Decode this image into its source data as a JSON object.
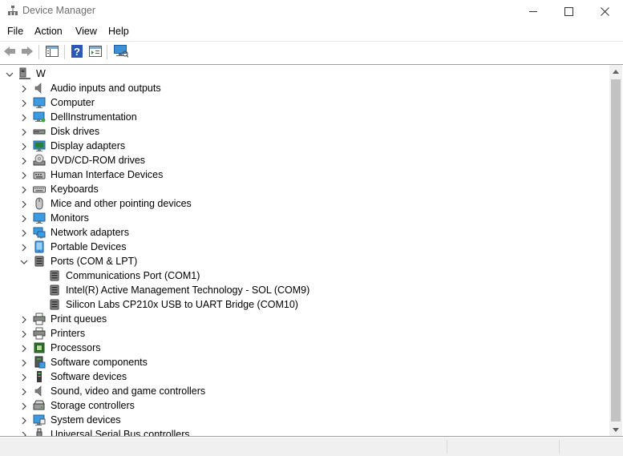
{
  "window": {
    "title": "Device Manager",
    "controls": {
      "minimize": "minimize",
      "maximize": "maximize",
      "close": "close"
    }
  },
  "menu": [
    "File",
    "Action",
    "View",
    "Help"
  ],
  "toolbar": {
    "buttons": [
      "back-icon",
      "forward-icon",
      "show-hide-console-tree-icon",
      "help-icon",
      "properties-icon",
      "scan-hardware-icon"
    ]
  },
  "tree": {
    "root": "W",
    "categories": [
      {
        "label": "Audio inputs and outputs",
        "icon": "speaker-icon",
        "expanded": false
      },
      {
        "label": "Computer",
        "icon": "monitor-icon",
        "expanded": false
      },
      {
        "label": "DellInstrumentation",
        "icon": "network-monitor-icon",
        "expanded": false
      },
      {
        "label": "Disk drives",
        "icon": "disk-drive-icon",
        "expanded": false
      },
      {
        "label": "Display adapters",
        "icon": "display-adapter-icon",
        "expanded": false
      },
      {
        "label": "DVD/CD-ROM drives",
        "icon": "dvd-icon",
        "expanded": false
      },
      {
        "label": "Human Interface Devices",
        "icon": "hid-icon",
        "expanded": false
      },
      {
        "label": "Keyboards",
        "icon": "keyboard-icon",
        "expanded": false
      },
      {
        "label": "Mice and other pointing devices",
        "icon": "mouse-icon",
        "expanded": false
      },
      {
        "label": "Monitors",
        "icon": "monitor-icon",
        "expanded": false
      },
      {
        "label": "Network adapters",
        "icon": "network-adapter-icon",
        "expanded": false
      },
      {
        "label": "Portable Devices",
        "icon": "portable-device-icon",
        "expanded": false
      },
      {
        "label": "Ports (COM & LPT)",
        "icon": "port-icon",
        "expanded": true,
        "children": [
          "Communications Port (COM1)",
          "Intel(R) Active Management Technology - SOL (COM9)",
          "Silicon Labs CP210x USB to UART Bridge (COM10)"
        ]
      },
      {
        "label": "Print queues",
        "icon": "printer-icon",
        "expanded": false
      },
      {
        "label": "Printers",
        "icon": "printer-icon",
        "expanded": false
      },
      {
        "label": "Processors",
        "icon": "processor-icon",
        "expanded": false
      },
      {
        "label": "Software components",
        "icon": "software-component-icon",
        "expanded": false
      },
      {
        "label": "Software devices",
        "icon": "software-device-icon",
        "expanded": false
      },
      {
        "label": "Sound, video and game controllers",
        "icon": "speaker-icon",
        "expanded": false
      },
      {
        "label": "Storage controllers",
        "icon": "storage-controller-icon",
        "expanded": false
      },
      {
        "label": "System devices",
        "icon": "system-device-icon",
        "expanded": false
      },
      {
        "label": "Universal Serial Bus controllers",
        "icon": "usb-icon",
        "expanded": false
      }
    ]
  }
}
